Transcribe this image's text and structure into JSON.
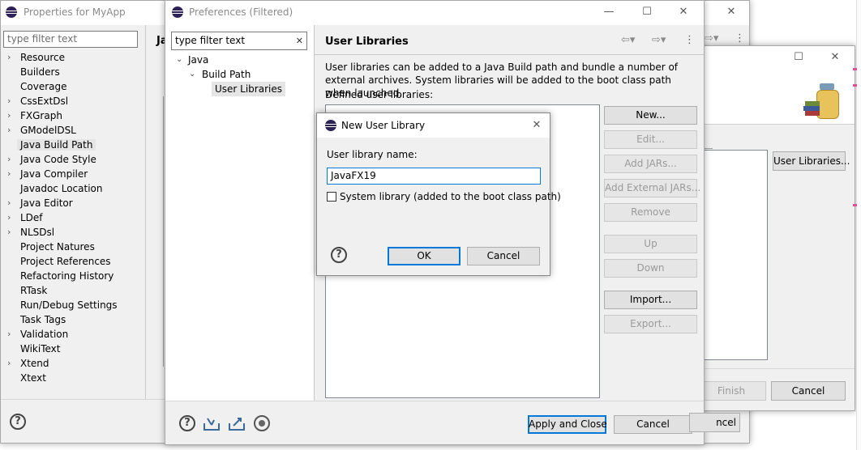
{
  "properties_window": {
    "title": "Properties for MyApp",
    "filter_placeholder": "type filter text",
    "items": [
      "Resource",
      "Builders",
      "Coverage",
      "CssExtDsl",
      "FXGraph",
      "GModelDSL",
      "Java Build Path",
      "Java Code Style",
      "Java Compiler",
      "Javadoc Location",
      "Java Editor",
      "LDef",
      "NLSDsl",
      "Project Natures",
      "Project References",
      "Refactoring History",
      "RTask",
      "Run/Debug Settings",
      "Task Tags",
      "Validation",
      "WikiText",
      "Xtend",
      "Xtext"
    ],
    "expandable": [
      true,
      false,
      false,
      true,
      true,
      true,
      false,
      true,
      true,
      false,
      true,
      true,
      true,
      false,
      false,
      false,
      false,
      false,
      false,
      true,
      false,
      true,
      false
    ],
    "selected_index": 6,
    "partial_header": "Ja",
    "cancel_partial": "ncel"
  },
  "wizard_window": {
    "user_libraries_button": "User Libraries...",
    "finish_button": "Finish",
    "cancel_button": "Cancel"
  },
  "preferences_window": {
    "title": "Preferences (Filtered)",
    "filter_value": "type filter text",
    "tree": {
      "java": "Java",
      "build_path": "Build Path",
      "user_libraries": "User Libraries"
    },
    "page_title": "User Libraries",
    "description": "User libraries can be added to a Java Build path and bundle a number of external archives. System libraries will be added to the boot class path when launched.",
    "defined_label": "Defined user libraries:",
    "buttons": {
      "new": "New...",
      "edit": "Edit...",
      "add_jars": "Add JARs...",
      "add_external_jars": "Add External JARs...",
      "remove": "Remove",
      "up": "Up",
      "down": "Down",
      "import": "Import...",
      "export": "Export..."
    },
    "apply_close": "Apply and Close",
    "cancel": "Cancel"
  },
  "new_library_dialog": {
    "title": "New User Library",
    "name_label": "User library name:",
    "name_value": "JavaFX19",
    "system_library_label": "System library (added to the boot class path)",
    "system_library_checked": false,
    "ok": "OK",
    "cancel": "Cancel"
  },
  "colors": {
    "accent": "#0078d7",
    "selection": "#e5e5e5",
    "window_bg": "#f0f0f0"
  }
}
